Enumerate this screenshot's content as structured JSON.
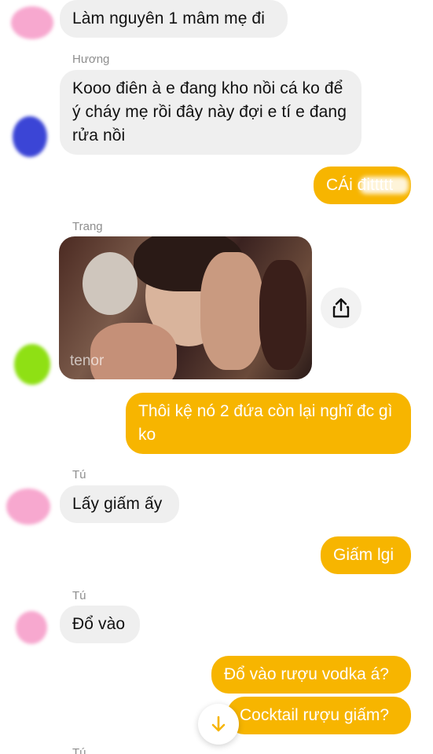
{
  "messages": [
    {
      "text": "Làm nguyên 1 mâm mẹ đi"
    },
    {
      "sender": "Hương",
      "text": "Kooo điên à e đang kho nồi cá ko để ý cháy mẹ rồi đây này đợi e tí e đang rửa nồi"
    },
    {
      "text": "CÁi đittttt"
    },
    {
      "sender": "Trang",
      "gif_label": "tenor"
    },
    {
      "text": "Thôi kệ nó 2 đứa còn lại nghĩ đc gì ko"
    },
    {
      "sender": "Tú",
      "text": "Lấy giấm ấy"
    },
    {
      "text": "Giấm lgi"
    },
    {
      "sender": "Tú",
      "text": "Đổ vào"
    },
    {
      "text": "Đổ vào rượu vodka á?"
    },
    {
      "text": "Cocktail rượu giấm?"
    },
    {
      "sender": "Tú"
    }
  ],
  "icons": {
    "share": "share-icon",
    "scroll_down": "arrow-down-icon"
  },
  "colors": {
    "outgoing_bubble": "#f7b500",
    "incoming_bubble": "#efefef",
    "sender_name": "#8e8e8e"
  }
}
